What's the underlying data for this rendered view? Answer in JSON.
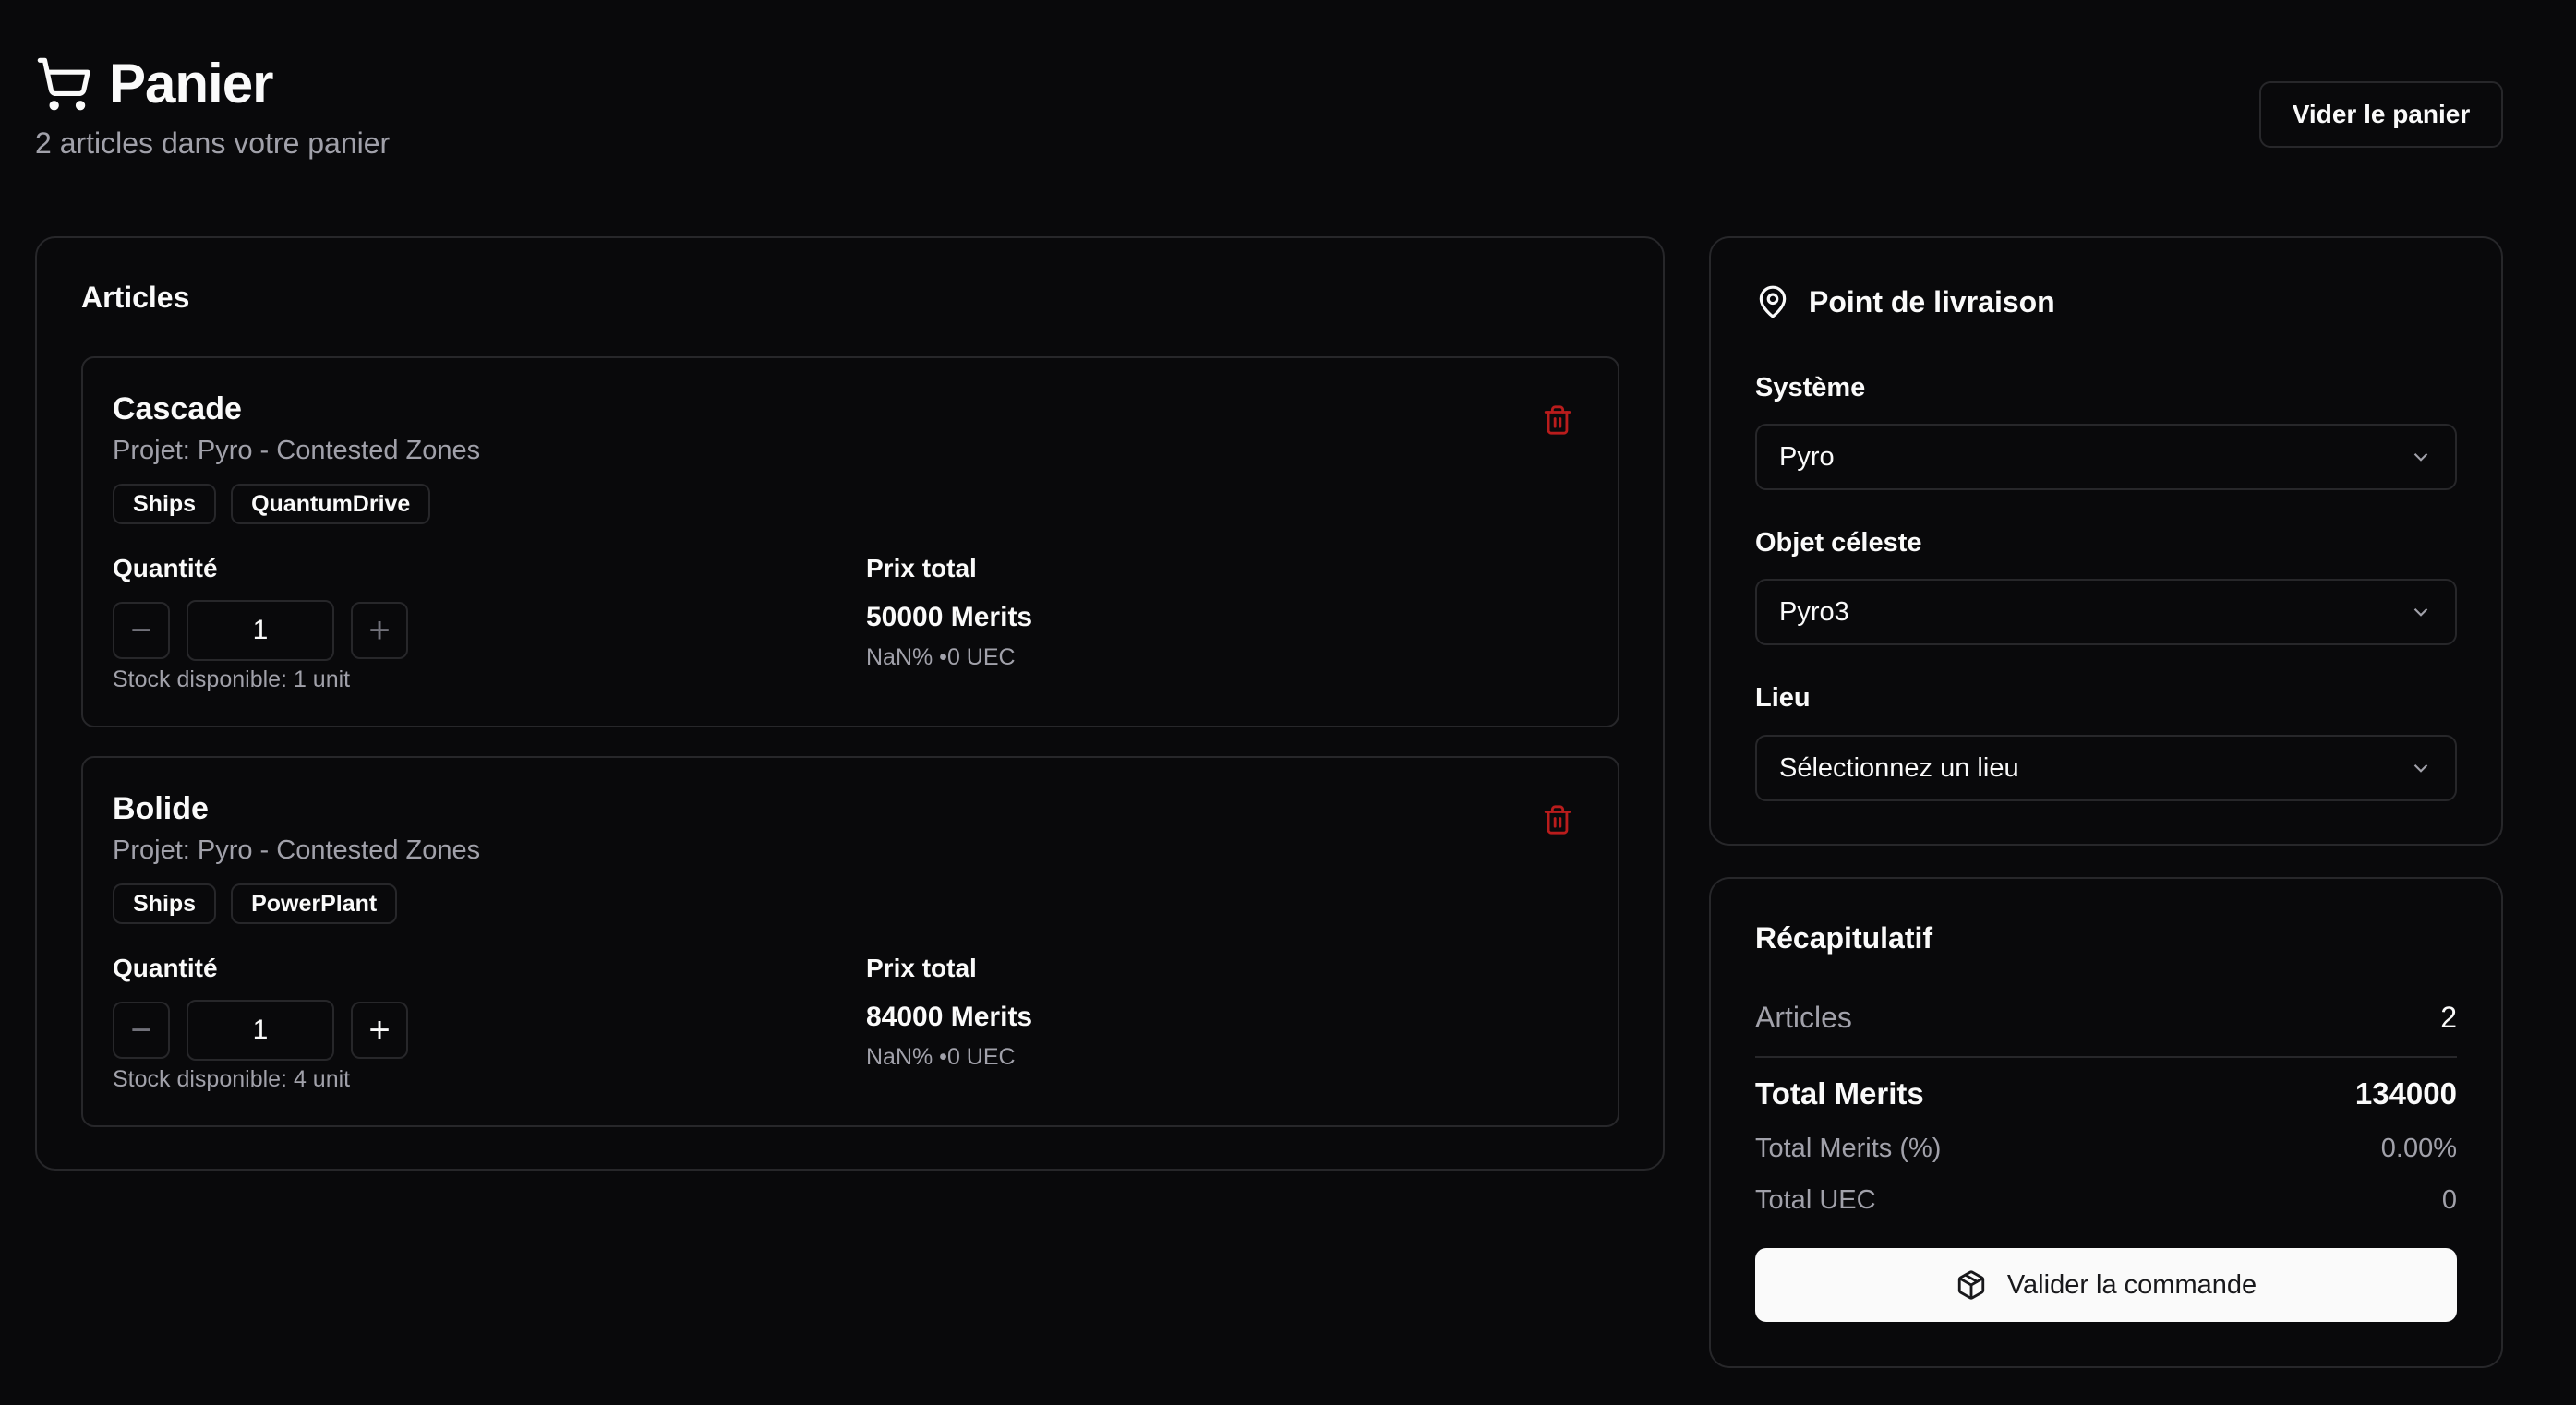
{
  "header": {
    "title": "Panier",
    "subtitle": "2 articles dans votre panier",
    "clear_label": "Vider le panier"
  },
  "articles": {
    "heading": "Articles",
    "qty_label": "Quantité",
    "price_label": "Prix total",
    "items": [
      {
        "name": "Cascade",
        "project": "Projet: Pyro - Contested Zones",
        "tags": [
          "Ships",
          "QuantumDrive"
        ],
        "quantity": "1",
        "stock": "Stock disponible: 1 unit",
        "price": "50000 Merits",
        "price_sub": "NaN% •0 UEC"
      },
      {
        "name": "Bolide",
        "project": "Projet: Pyro - Contested Zones",
        "tags": [
          "Ships",
          "PowerPlant"
        ],
        "quantity": "1",
        "stock": "Stock disponible: 4 unit",
        "price": "84000 Merits",
        "price_sub": "NaN% •0 UEC"
      }
    ]
  },
  "delivery": {
    "title": "Point de livraison",
    "system_label": "Système",
    "system_value": "Pyro",
    "object_label": "Objet céleste",
    "object_value": "Pyro3",
    "place_label": "Lieu",
    "place_value": "Sélectionnez un lieu"
  },
  "summary": {
    "title": "Récapitulatif",
    "articles_label": "Articles",
    "articles_value": "2",
    "total_merits_label": "Total Merits",
    "total_merits_value": "134000",
    "pct_label": "Total Merits (%)",
    "pct_value": "0.00%",
    "uec_label": "Total UEC",
    "uec_value": "0",
    "validate_label": "Valider la commande"
  },
  "colors": {
    "background": "#09090b",
    "border": "#27272a",
    "muted_text": "#a1a1aa",
    "danger": "#b91c1c",
    "primary_button": "#fafafa"
  },
  "icons": [
    "cart-icon",
    "trash-icon",
    "minus-icon",
    "plus-icon",
    "map-pin-icon",
    "chevron-down-icon",
    "package-icon"
  ]
}
